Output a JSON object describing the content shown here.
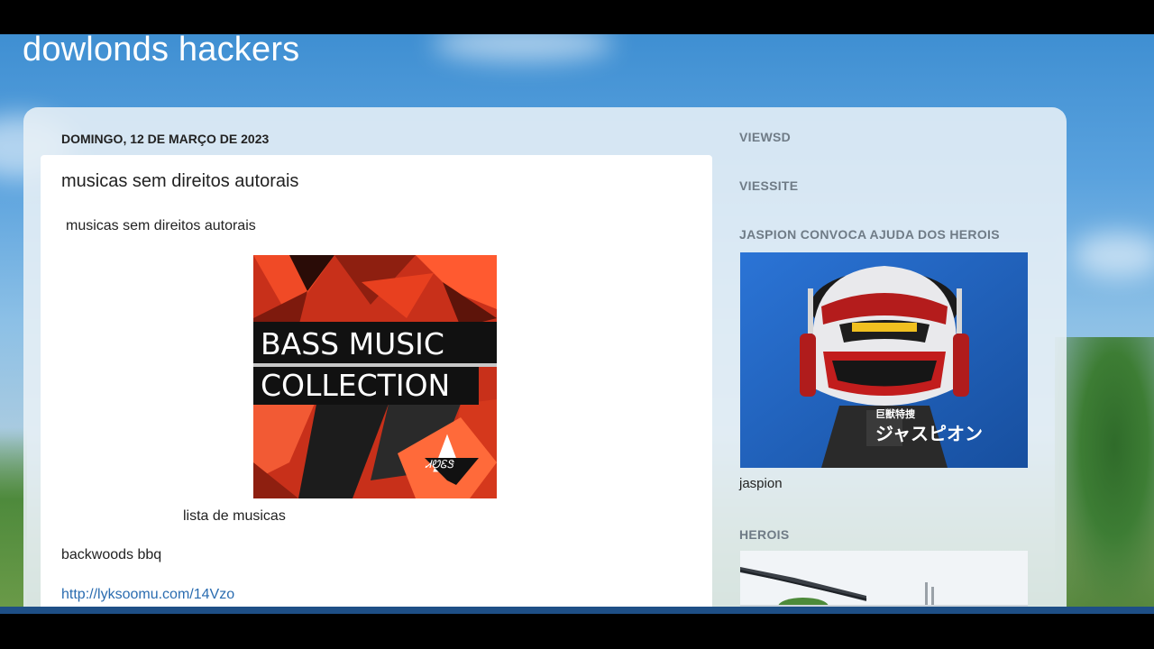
{
  "blog": {
    "title": "dowlonds hackers"
  },
  "post": {
    "date": "DOMINGO, 12 DE MARÇO DE 2023",
    "title": "musicas sem direitos autorais",
    "intro": "musicas sem direitos autorais",
    "album_cover": {
      "line1": "BASS MUSIC",
      "line2": "COLLECTION",
      "badge": "ᏗᏬᏋᏕ"
    },
    "album_caption": "lista de musicas",
    "track": "backwoods bbq",
    "link": "http://lyksoomu.com/14Vzo"
  },
  "sidebar": {
    "heading_viewsd": "VIEWSD",
    "heading_viessite": "VIESSITE",
    "heading_jaspion": "JASPION CONVOCA AJUDA DOS HEROIS",
    "jaspion_logo": "巨獣特捜 ジャスピオン",
    "jaspion_caption": "jaspion",
    "heading_herois": "HEROIS"
  },
  "colors": {
    "sky": "#4f98d8",
    "panel": "#e8f0f6",
    "album_red": "#d9331b",
    "jaspion_blue": "#1f5fbf",
    "link": "#2a6cb0"
  }
}
